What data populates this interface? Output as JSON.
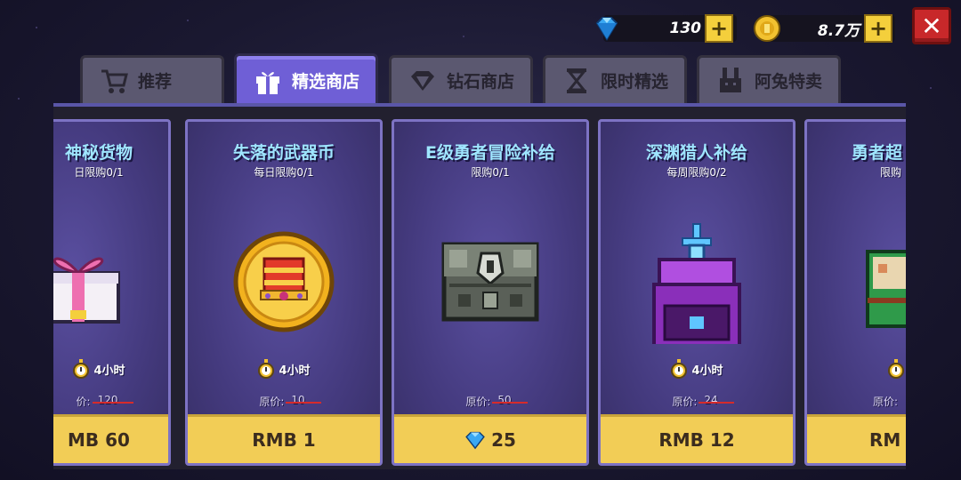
{
  "currency": {
    "gems": "130",
    "coins": "8.7万",
    "gem_color": "#3aa8f2",
    "coin_color": "#f2c230",
    "plus_label": "+"
  },
  "close_label": "✕",
  "tabs": [
    {
      "label": "推荐",
      "icon": "shopping-cart-icon",
      "active": false
    },
    {
      "label": "精选商店",
      "icon": "gift-icon",
      "active": true
    },
    {
      "label": "钻石商店",
      "icon": "diamond-icon",
      "active": false
    },
    {
      "label": "限时精选",
      "icon": "hourglass-icon",
      "active": false
    },
    {
      "label": "阿兔特卖",
      "icon": "rabbit-icon",
      "active": false
    }
  ],
  "cards": [
    {
      "title": "神秘货物",
      "limit": "日限购0/1",
      "timer": "4小时",
      "orig_label": "价:",
      "orig_price": "120",
      "price": "MB 60",
      "icon": "pink-gift-box-icon"
    },
    {
      "title": "失落的武器币",
      "limit": "每日限购0/1",
      "timer": "4小时",
      "orig_label": "原价:",
      "orig_price": "10",
      "price": "RMB 1",
      "icon": "gold-coin-icon"
    },
    {
      "title": "E级勇者冒险补给",
      "limit": "限购0/1",
      "timer": "",
      "orig_label": "原价:",
      "orig_price": "50",
      "price": "25",
      "price_icon": "gem-icon",
      "icon": "stone-chest-icon"
    },
    {
      "title": "深渊猎人补给",
      "limit": "每周限购0/2",
      "timer": "4小时",
      "orig_label": "原价:",
      "orig_price": "24",
      "price": "RMB 12",
      "icon": "purple-sword-chest-icon"
    },
    {
      "title": "勇者超",
      "limit": "限购",
      "timer": "",
      "orig_label": "原价:",
      "orig_price": "",
      "price": "RM",
      "icon": "green-book-icon"
    }
  ]
}
